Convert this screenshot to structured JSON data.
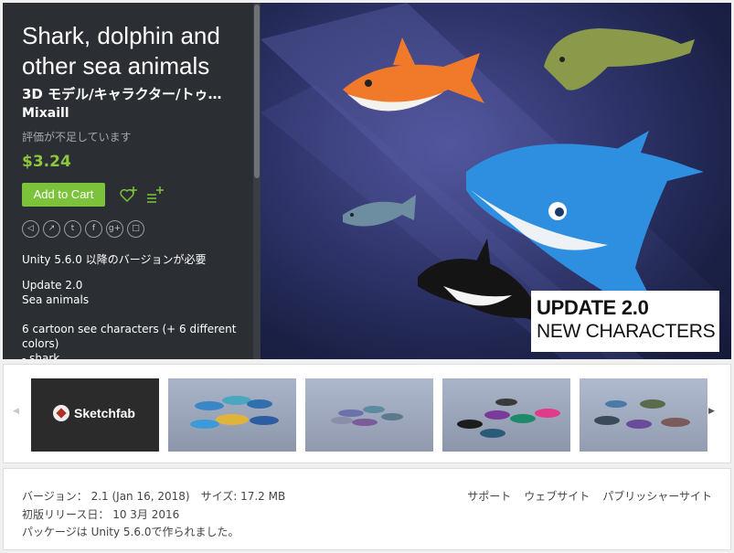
{
  "product": {
    "title": "Shark, dolphin and other sea animals",
    "category": "3D モデル/キャラクター/トゥ…",
    "publisher": "Mixaill",
    "rating_text": "評価が不足しています",
    "price": "$3.24",
    "add_to_cart_label": "Add to Cart",
    "description": {
      "requirement": "Unity 5.6.0 以降のバージョンが必要",
      "update_line1": "Update 2.0",
      "update_line2": "Sea animals",
      "characters_line": "6 cartoon see characters (+ 6 different colors)",
      "list_first": "- shark"
    }
  },
  "social_icons": [
    "telegram-icon",
    "share-icon",
    "twitter-icon",
    "facebook-icon",
    "google-plus-icon",
    "comment-icon"
  ],
  "social_glyphs": [
    "◁",
    "↗",
    "t",
    "f",
    "g+",
    "□"
  ],
  "hero": {
    "caption_line1": "UPDATE 2.0",
    "caption_line2": "NEW CHARACTERS"
  },
  "thumbnails": {
    "sketchfab_label": "Sketchfab",
    "prev_arrow": "◀",
    "next_arrow": "▶"
  },
  "info": {
    "version": "バージョン： 2.1 (Jan 16, 2018)　サイズ: 17.2 MB",
    "release": "初版リリース日： 10 3月 2016",
    "package": "パッケージは Unity 5.6.0で作られました。",
    "links": [
      "サポート",
      "ウェブサイト",
      "パブリッシャーサイト"
    ]
  },
  "colors": {
    "sidebar_bg": "#2b2e33",
    "accent_green": "#7cc33b",
    "price_green": "#8dc63f"
  }
}
